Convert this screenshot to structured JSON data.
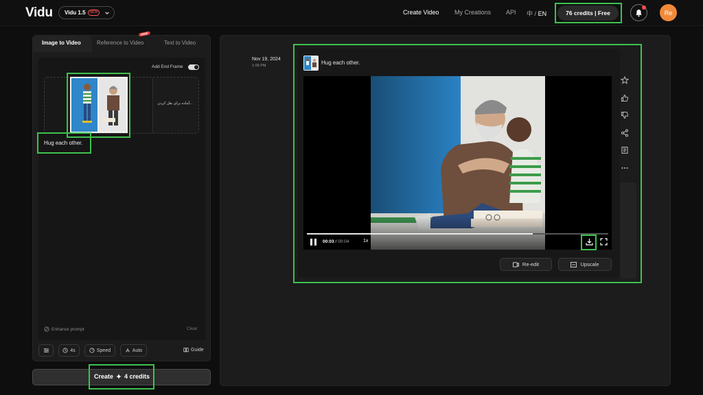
{
  "header": {
    "logo": "Vidu",
    "model_label": "Vidu 1.5",
    "model_badge": "NEW",
    "nav": [
      "Create Video",
      "My Creations",
      "API"
    ],
    "lang_zh": "中",
    "lang_sep": "/",
    "lang_en": "EN",
    "credits": "76 credits | Free",
    "avatar": "Re"
  },
  "left": {
    "tabs": [
      "Image to Video",
      "Reference to Video",
      "Text to Video"
    ],
    "tab_badge": "NEW",
    "add_end_frame": "Add End Frame",
    "end_frame_text": "...آماده برای بغل کردن",
    "prompt": "Hug each other.",
    "enhance": "Enhance prompt",
    "clear": "Clear",
    "opts": {
      "duration": "4s",
      "speed": "Speed",
      "auto": "Auto",
      "guide": "Guide"
    },
    "create": "Create",
    "create_credits": "4 credits"
  },
  "result": {
    "date": "Nov 19, 2024",
    "time": "1:09 PM",
    "prompt": "Hug each other.",
    "current_time": "00:03",
    "time_sep": "/",
    "duration": "00:04",
    "rate": "1x",
    "progress": 0.75,
    "reedit": "Re-edit",
    "upscale": "Upscale"
  },
  "colors": {
    "highlight": "#3fc24f",
    "avatar": "#f08a3a",
    "notif_dot": "#ff4a4a"
  },
  "icons": [
    "bell-icon",
    "star-icon",
    "thumbs-up-icon",
    "thumbs-down-icon",
    "share-icon",
    "document-icon",
    "more-icon",
    "pause-icon",
    "download-icon",
    "fullscreen-icon",
    "sliders-icon",
    "clock-icon",
    "speed-icon",
    "auto-icon",
    "book-icon",
    "sparkle-icon"
  ]
}
